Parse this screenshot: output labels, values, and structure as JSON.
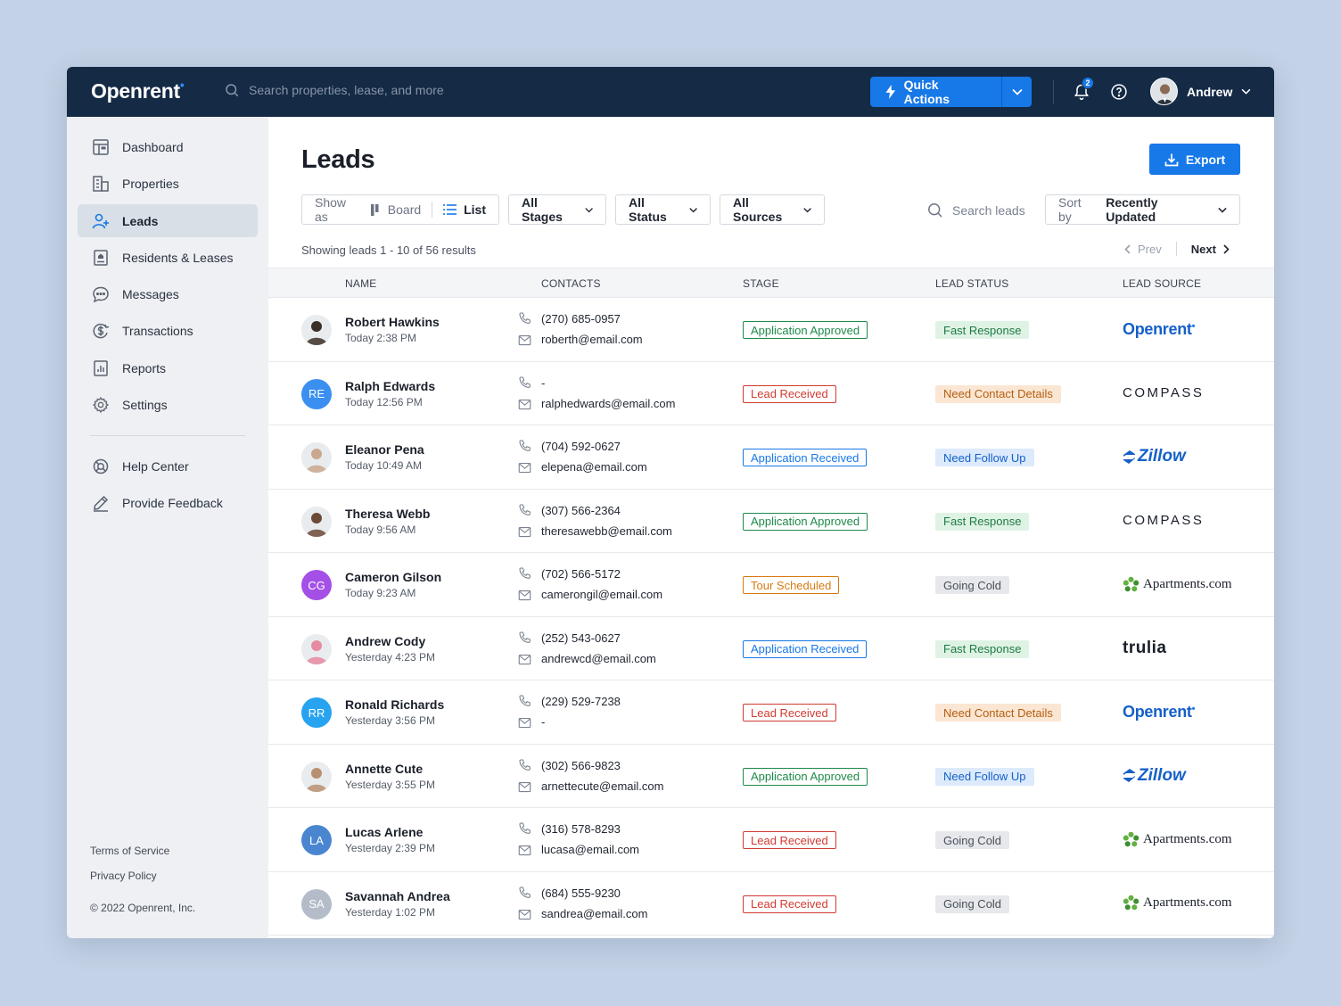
{
  "app": {
    "logo": "Openrent",
    "logo_dot": "•"
  },
  "topbar": {
    "search_placeholder": "Search properties, lease, and more",
    "quick_actions": "Quick Actions",
    "notifications_count": "2",
    "user_name": "Andrew"
  },
  "sidebar": {
    "items": [
      {
        "label": "Dashboard",
        "icon": "dashboard-icon"
      },
      {
        "label": "Properties",
        "icon": "building-icon"
      },
      {
        "label": "Leads",
        "icon": "leads-icon",
        "active": true
      },
      {
        "label": "Residents & Leases",
        "icon": "document-icon"
      },
      {
        "label": "Messages",
        "icon": "chat-icon"
      },
      {
        "label": "Transactions",
        "icon": "dollar-icon"
      },
      {
        "label": "Reports",
        "icon": "report-icon"
      },
      {
        "label": "Settings",
        "icon": "gear-icon"
      }
    ],
    "secondary": [
      {
        "label": "Help Center",
        "icon": "help-center-icon"
      },
      {
        "label": "Provide Feedback",
        "icon": "pencil-icon"
      }
    ],
    "footer": {
      "terms": "Terms of Service",
      "privacy": "Privacy Policy",
      "copyright": "© 2022 Openrent, Inc."
    }
  },
  "main": {
    "title": "Leads",
    "export": "Export",
    "view": {
      "show_as": "Show as",
      "board": "Board",
      "list": "List"
    },
    "filters": {
      "stages": "All Stages",
      "status": "All Status",
      "sources": "All Sources"
    },
    "search_placeholder": "Search leads",
    "sort": {
      "label": "Sort by",
      "value": "Recently Updated"
    },
    "results_text": "Showing leads 1 - 10 of 56 results",
    "pager": {
      "prev": "Prev",
      "next": "Next"
    },
    "columns": [
      "NAME",
      "CONTACTS",
      "STAGE",
      "LEAD STATUS",
      "LEAD SOURCE"
    ],
    "leads": [
      {
        "name": "Robert Hawkins",
        "time": "Today 2:38 PM",
        "phone": "(270) 685-0957",
        "email": "roberth@email.com",
        "stage": "Application Approved",
        "status": "Fast Response",
        "source": "Openrent",
        "avatar": "photo",
        "avatar_color": "#3b3028"
      },
      {
        "name": "Ralph Edwards",
        "time": "Today 12:56 PM",
        "phone": "-",
        "email": "ralphedwards@email.com",
        "stage": "Lead Received",
        "status": "Need Contact Details",
        "source": "COMPASS",
        "avatar": "RE",
        "avatar_color": "#3b8ff0"
      },
      {
        "name": "Eleanor Pena",
        "time": "Today 10:49 AM",
        "phone": "(704) 592-0627",
        "email": "elepena@email.com",
        "stage": "Application Received",
        "status": "Need Follow Up",
        "source": "Zillow",
        "avatar": "photo",
        "avatar_color": "#c9a88e"
      },
      {
        "name": "Theresa Webb",
        "time": "Today 9:56 AM",
        "phone": "(307) 566-2364",
        "email": "theresawebb@email.com",
        "stage": "Application Approved",
        "status": "Fast Response",
        "source": "COMPASS",
        "avatar": "photo",
        "avatar_color": "#6b4a36"
      },
      {
        "name": "Cameron Gilson",
        "time": "Today 9:23 AM",
        "phone": "(702) 566-5172",
        "email": "camerongil@email.com",
        "stage": "Tour Scheduled",
        "status": "Going Cold",
        "source": "Apartments.com",
        "avatar": "CG",
        "avatar_color": "#a44fe6"
      },
      {
        "name": "Andrew Cody",
        "time": "Yesterday 4:23 PM",
        "phone": "(252) 543-0627",
        "email": "andrewcd@email.com",
        "stage": "Application Received",
        "status": "Fast Response",
        "source": "trulia",
        "avatar": "photo",
        "avatar_color": "#e58aa0"
      },
      {
        "name": "Ronald Richards",
        "time": "Yesterday 3:56 PM",
        "phone": "(229) 529-7238",
        "email": "-",
        "stage": "Lead Received",
        "status": "Need Contact Details",
        "source": "Openrent",
        "avatar": "RR",
        "avatar_color": "#27a3f0"
      },
      {
        "name": "Annette Cute",
        "time": "Yesterday 3:55 PM",
        "phone": "(302) 566-9823",
        "email": "arnettecute@email.com",
        "stage": "Application Approved",
        "status": "Need Follow Up",
        "source": "Zillow",
        "avatar": "photo",
        "avatar_color": "#b89070"
      },
      {
        "name": "Lucas Arlene",
        "time": "Yesterday 2:39 PM",
        "phone": "(316) 578-8293",
        "email": "lucasa@email.com",
        "stage": "Lead Received",
        "status": "Going Cold",
        "source": "Apartments.com",
        "avatar": "LA",
        "avatar_color": "#4a86d0"
      },
      {
        "name": "Savannah Andrea",
        "time": "Yesterday 1:02 PM",
        "phone": "(684) 555-9230",
        "email": "sandrea@email.com",
        "stage": "Lead Received",
        "status": "Going Cold",
        "source": "Apartments.com",
        "avatar": "SA",
        "avatar_color": "#b3bcc8"
      }
    ]
  },
  "colors": {
    "topbar": "#142a45",
    "primary": "#1778e8",
    "stage_approved": "#1e8a4a",
    "stage_received": "#1778e8",
    "stage_lead": "#d03b30",
    "stage_tour": "#d87a12",
    "status_fast_bg": "#dff3e5",
    "status_contact_bg": "#fae6d2",
    "status_followup_bg": "#dceafc",
    "status_cold_bg": "#e6e8eb"
  }
}
